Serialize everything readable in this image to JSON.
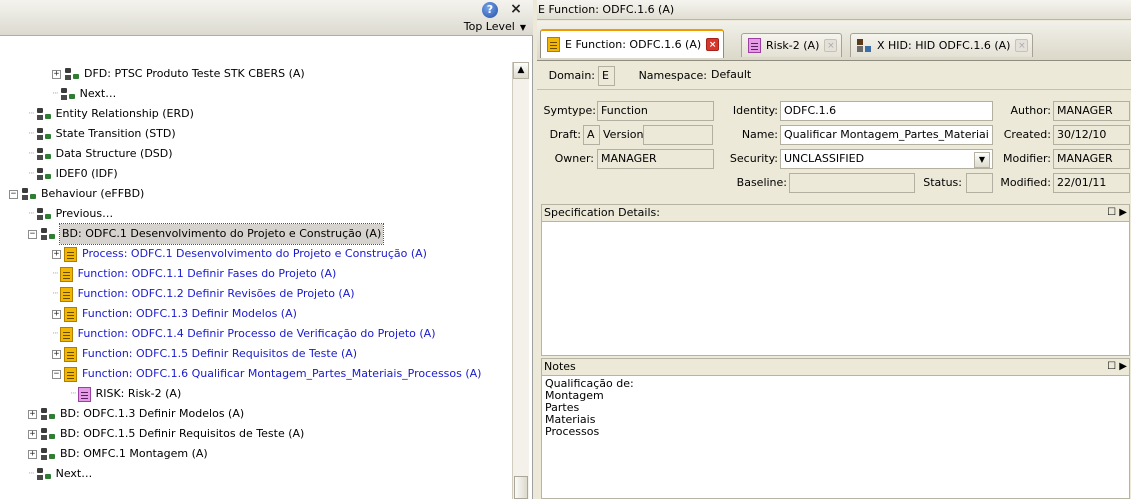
{
  "left": {
    "help_label": "?",
    "close_label": "×",
    "level": "Top Level",
    "scroll_up": "▲"
  },
  "tree": [
    {
      "indent": 2,
      "exp": "+",
      "icon": "diagram",
      "label": "DFD: PTSC Produto Teste STK CBERS (A)",
      "blue": false
    },
    {
      "indent": 2,
      "exp": "",
      "icon": "diagram",
      "label": "Next…",
      "blue": false
    },
    {
      "indent": 1,
      "exp": "",
      "icon": "diagram",
      "label": "Entity Relationship (ERD)",
      "blue": false
    },
    {
      "indent": 1,
      "exp": "",
      "icon": "diagram",
      "label": "State Transition (STD)",
      "blue": false
    },
    {
      "indent": 1,
      "exp": "",
      "icon": "diagram",
      "label": "Data Structure (DSD)",
      "blue": false
    },
    {
      "indent": 1,
      "exp": "",
      "icon": "diagram",
      "label": "IDEF0 (IDF)",
      "blue": false
    },
    {
      "indent": 0,
      "exp": "−",
      "icon": "diagram",
      "label": "Behaviour (eFFBD)",
      "blue": false
    },
    {
      "indent": 1,
      "exp": "",
      "icon": "diagram",
      "label": "Previous…",
      "blue": false
    },
    {
      "indent": 1,
      "exp": "−",
      "icon": "diagram",
      "label": "BD: ODFC.1 Desenvolvimento do Projeto e Construção (A)",
      "blue": false,
      "selected": true
    },
    {
      "indent": 2,
      "exp": "+",
      "icon": "func",
      "label": "Process: ODFC.1 Desenvolvimento do Projeto e Construção (A)",
      "blue": true
    },
    {
      "indent": 2,
      "exp": "",
      "icon": "func",
      "label": "Function: ODFC.1.1 Definir Fases do Projeto (A)",
      "blue": true
    },
    {
      "indent": 2,
      "exp": "",
      "icon": "func",
      "label": "Function: ODFC.1.2 Definir Revisões de Projeto (A)",
      "blue": true
    },
    {
      "indent": 2,
      "exp": "+",
      "icon": "func",
      "label": "Function: ODFC.1.3 Definir Modelos (A)",
      "blue": true
    },
    {
      "indent": 2,
      "exp": "",
      "icon": "func",
      "label": "Function: ODFC.1.4 Definir Processo de Verificação do Projeto (A)",
      "blue": true
    },
    {
      "indent": 2,
      "exp": "+",
      "icon": "func",
      "label": "Function: ODFC.1.5 Definir Requisitos de Teste (A)",
      "blue": true
    },
    {
      "indent": 2,
      "exp": "−",
      "icon": "func",
      "label": "Function: ODFC.1.6 Qualificar Montagem_Partes_Materiais_Processos (A)",
      "blue": true
    },
    {
      "indent": 3,
      "exp": "",
      "icon": "risk",
      "label": "RISK: Risk-2   (A)",
      "blue": false
    },
    {
      "indent": 1,
      "exp": "+",
      "icon": "diagram",
      "label": "BD: ODFC.1.3 Definir Modelos (A)",
      "blue": false
    },
    {
      "indent": 1,
      "exp": "+",
      "icon": "diagram",
      "label": "BD: ODFC.1.5 Definir Requisitos de Teste (A)",
      "blue": false
    },
    {
      "indent": 1,
      "exp": "+",
      "icon": "diagram",
      "label": "BD: OMFC.1 Montagem (A)",
      "blue": false
    },
    {
      "indent": 1,
      "exp": "",
      "icon": "diagram",
      "label": "Next…",
      "blue": false
    }
  ],
  "right": {
    "title": "E Function: ODFC.1.6 (A)",
    "tabs": [
      {
        "icon": "func",
        "label": "E Function: ODFC.1.6 (A)",
        "close": "×",
        "active": true
      },
      {
        "icon": "risk",
        "label": "Risk-2 (A)",
        "close": "×",
        "active": false
      },
      {
        "icon": "hid",
        "label": "X HID: HID ODFC.1.6 (A)",
        "close": "×",
        "active": false
      }
    ],
    "domain_label": "Domain:",
    "domain_value": "E",
    "namespace_label": "Namespace:",
    "namespace_value": "Default",
    "symtype_label": "Symtype:",
    "symtype_value": "Function",
    "draft_label": "Draft:",
    "draft_value": "A",
    "version_label": "Version:",
    "version_value": "",
    "owner_label": "Owner:",
    "owner_value": "MANAGER",
    "identity_label": "Identity:",
    "identity_value": "ODFC.1.6",
    "name_label": "Name:",
    "name_value": "Qualificar Montagem_Partes_Materiai",
    "security_label": "Security:",
    "security_value": "UNCLASSIFIED",
    "security_caret": "▼",
    "baseline_label": "Baseline:",
    "baseline_value": "",
    "status_label": "Status:",
    "status_value": "",
    "author_label": "Author:",
    "author_value": "MANAGER",
    "created_label": "Created:",
    "created_value": "30/12/10",
    "modifier_label": "Modifier:",
    "modifier_value": "MANAGER",
    "modified_label": "Modified:",
    "modified_value": "22/01/11",
    "spec_label": "Specification Details:",
    "panel_buttons": "☐ ▶",
    "notes_label": "Notes",
    "notes_lines": [
      "Qualificação de:",
      "Montagem",
      "Partes",
      "Materiais",
      "Processos"
    ]
  }
}
